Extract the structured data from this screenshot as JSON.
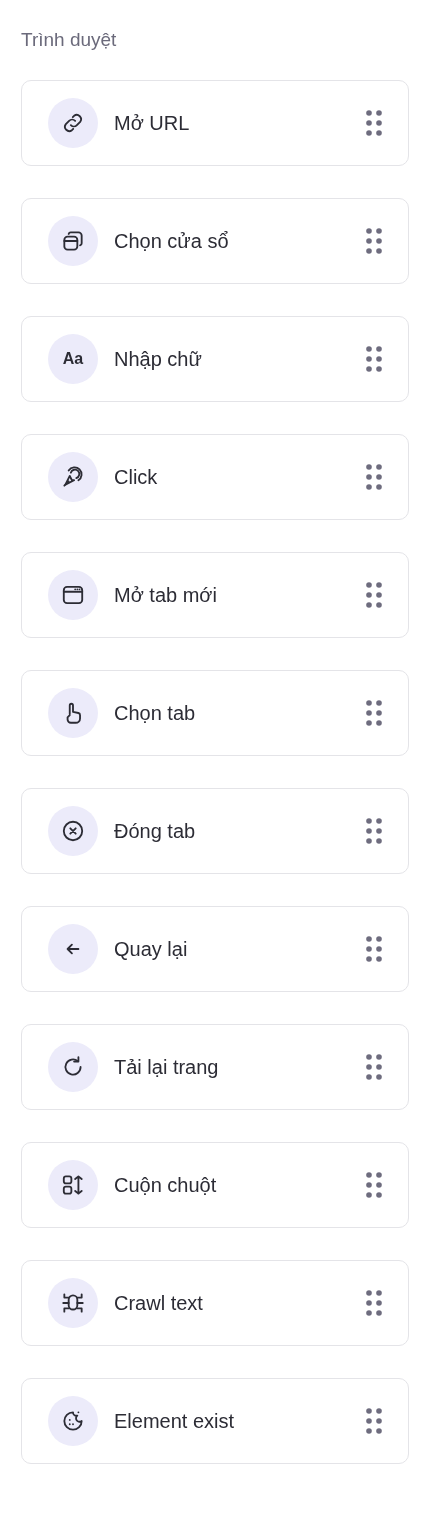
{
  "section_title": "Trình duyệt",
  "actions": [
    {
      "label": "Mở URL",
      "kind": "link"
    },
    {
      "label": "Chọn cửa sổ",
      "kind": "windows"
    },
    {
      "label": "Nhập chữ",
      "kind": "text",
      "icon_text": "Aa"
    },
    {
      "label": "Click",
      "kind": "click"
    },
    {
      "label": "Mở tab mới",
      "kind": "browser"
    },
    {
      "label": "Chọn tab",
      "kind": "hand"
    },
    {
      "label": "Đóng tab",
      "kind": "close"
    },
    {
      "label": "Quay lại",
      "kind": "back"
    },
    {
      "label": "Tải lại trang",
      "kind": "reload"
    },
    {
      "label": "Cuộn chuột",
      "kind": "scroll"
    },
    {
      "label": "Crawl text",
      "kind": "bug"
    },
    {
      "label": "Element exist",
      "kind": "cookie"
    }
  ]
}
